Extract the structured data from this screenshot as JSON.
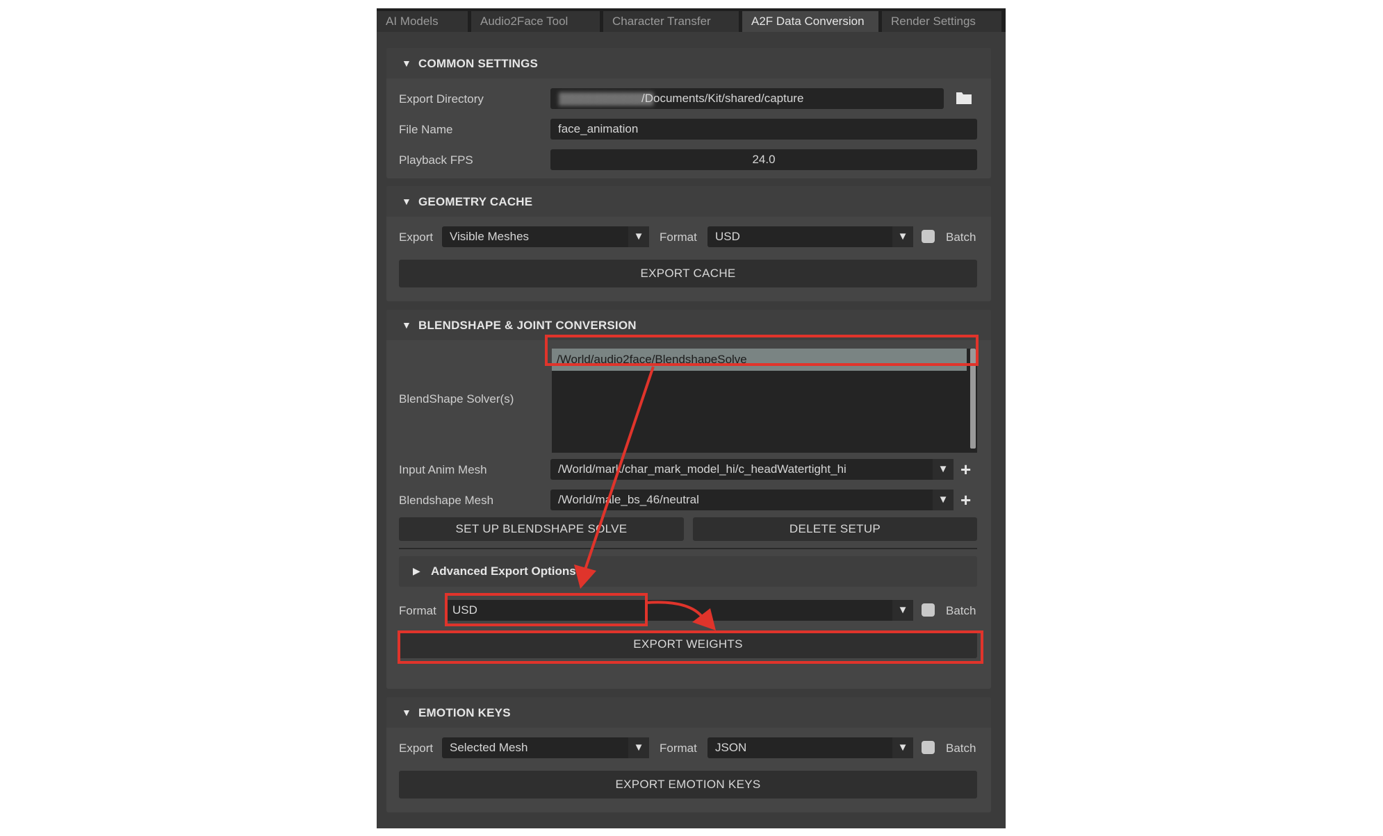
{
  "tabs": [
    {
      "label": "AI Models",
      "active": false
    },
    {
      "label": "Audio2Face Tool",
      "active": false
    },
    {
      "label": "Character Transfer",
      "active": false
    },
    {
      "label": "A2F Data Conversion",
      "active": true
    },
    {
      "label": "Render Settings",
      "active": false
    }
  ],
  "common": {
    "title": "COMMON SETTINGS",
    "export_dir_label": "Export Directory",
    "export_dir_value": "/Documents/Kit/shared/capture",
    "file_name_label": "File Name",
    "file_name_value": "face_animation",
    "fps_label": "Playback FPS",
    "fps_value": "24.0"
  },
  "geometry": {
    "title": "GEOMETRY CACHE",
    "export_label": "Export",
    "export_value": "Visible Meshes",
    "format_label": "Format",
    "format_value": "USD",
    "batch_label": "Batch",
    "button": "EXPORT CACHE"
  },
  "blendshape": {
    "title": "BLENDSHAPE & JOINT CONVERSION",
    "solvers_label": "BlendShape Solver(s)",
    "solvers": [
      "/World/audio2face/BlendshapeSolve"
    ],
    "input_mesh_label": "Input Anim Mesh",
    "input_mesh_value": "/World/mark/char_mark_model_hi/c_headWatertight_hi",
    "bs_mesh_label": "Blendshape Mesh",
    "bs_mesh_value": "/World/male_bs_46/neutral",
    "setup_button": "SET UP BLENDSHAPE SOLVE",
    "delete_button": "DELETE SETUP",
    "advanced_label": "Advanced Export Options",
    "format_label": "Format",
    "format_value": "USD",
    "batch_label": "Batch",
    "export_button": "EXPORT WEIGHTS"
  },
  "emotion": {
    "title": "EMOTION KEYS",
    "export_label": "Export",
    "export_value": "Selected Mesh",
    "format_label": "Format",
    "format_value": "JSON",
    "batch_label": "Batch",
    "button": "EXPORT EMOTION KEYS"
  },
  "colors": {
    "annotation": "#e0342b",
    "selected_row": "#7a8483",
    "panel_bg": "#3b3b3b"
  }
}
